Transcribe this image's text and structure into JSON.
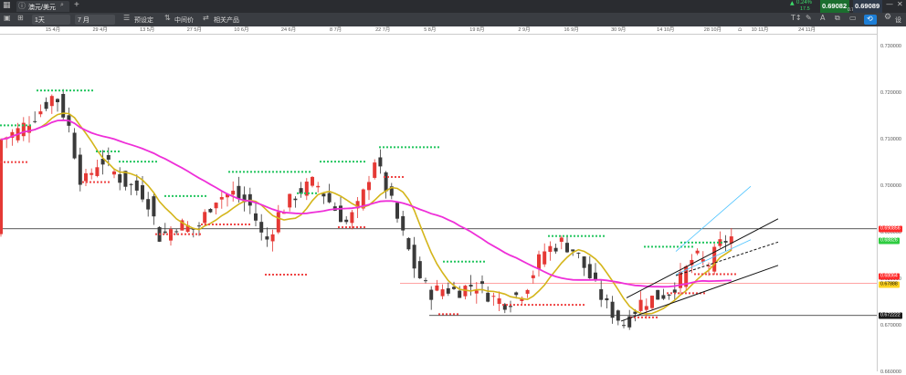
{
  "window": {
    "tab_title": "澳元/美元",
    "add_tab": "+"
  },
  "toolbar": {
    "timeframe": "1天",
    "range": "7 月",
    "preset_label": "预设定",
    "midprice_label": "中间价",
    "related_label": "相关产品"
  },
  "quote": {
    "change_pct": "0.24%",
    "change_abs": "17.5",
    "bid": "0.69082",
    "spread": "0.7",
    "ask": "0.69089",
    "settings_label": "设",
    "bid_color": "#1b6e2e",
    "ask_color": "#2f3a4a"
  },
  "chart_data": {
    "type": "candlestick",
    "x_ticks": [
      "15 4月",
      "29 4月",
      "13 5月",
      "27 5月",
      "10 6月",
      "24 6月",
      "8 7月",
      "22 7月",
      "5 8月",
      "19 8月",
      "2 9月",
      "16 9月",
      "30 9月",
      "14 10月",
      "28 10月",
      "10 11月",
      "24 11月"
    ],
    "y_ticks": [
      "0.730000",
      "0.720000",
      "0.710000",
      "0.700000",
      "0.690000",
      "0.680000",
      "0.670000",
      "0.660000"
    ],
    "ylim": [
      0.6602,
      0.7328
    ],
    "price_tags": [
      {
        "label": "0.690856",
        "value": 0.690856,
        "color": "#ff2a2a"
      },
      {
        "label": "0.68826",
        "value": 0.68826,
        "color": "#2ecc40"
      },
      {
        "label": "0.68064",
        "value": 0.68064,
        "color": "#ff2a2a"
      },
      {
        "label": "0.67888",
        "value": 0.67888,
        "color": "#ffd21f"
      },
      {
        "label": "0.672222",
        "value": 0.672222,
        "color": "#1a1a1a"
      }
    ],
    "horizontal_lines": [
      0.690856,
      0.6791,
      0.672222
    ],
    "ma_fast_color": "#d4b51a",
    "ma_slow_color": "#ee2fd8",
    "up_color": "#e53935",
    "down_color": "#3a3a3a"
  }
}
